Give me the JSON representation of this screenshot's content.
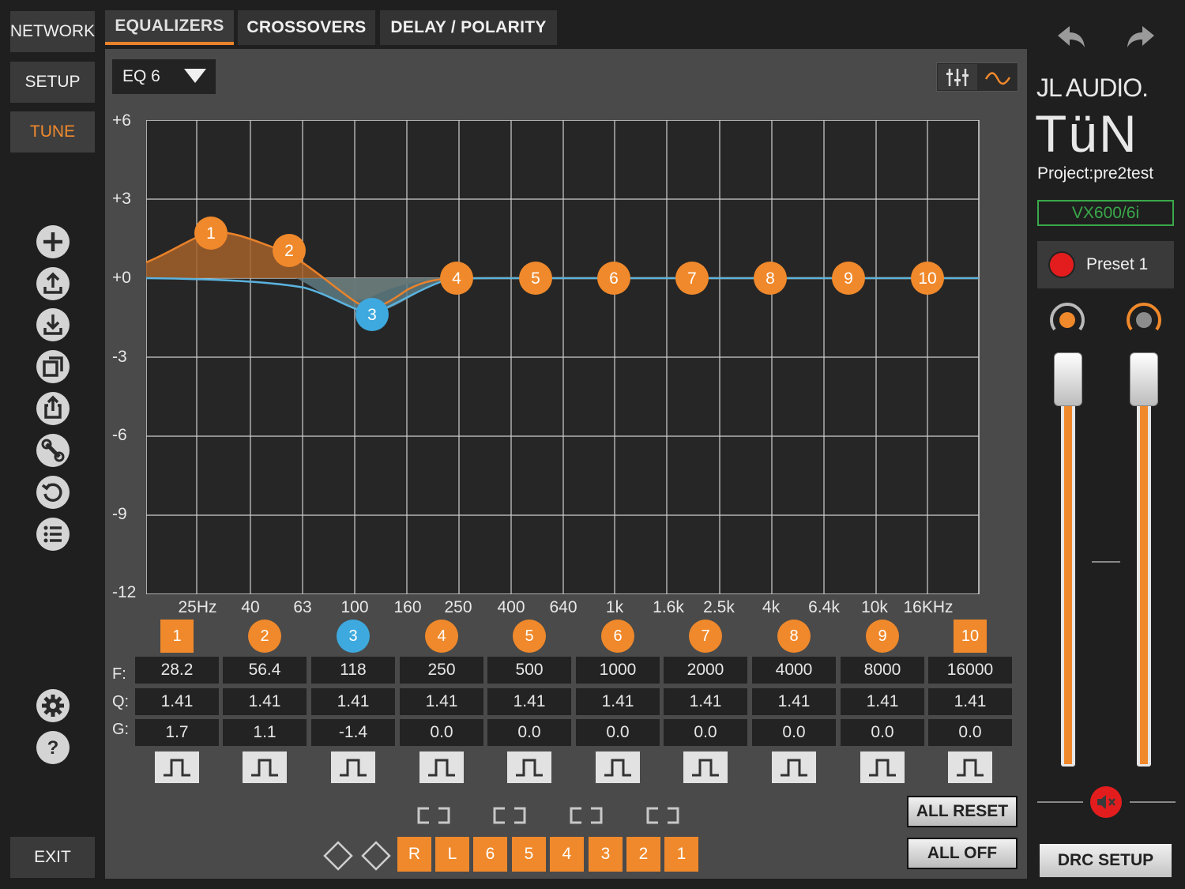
{
  "nav": {
    "network": "NETWORK",
    "setup": "SETUP",
    "tune": "TUNE",
    "exit": "EXIT"
  },
  "tabs": [
    {
      "label": "EQUALIZERS"
    },
    {
      "label": "CROSSOVERS"
    },
    {
      "label": "DELAY / POLARITY"
    }
  ],
  "eq_select": {
    "value": "EQ 6"
  },
  "graph": {
    "y_labels": [
      "+6",
      "+3",
      "+0",
      "-3",
      "-6",
      "-9",
      "-12"
    ],
    "x_labels": [
      "25Hz",
      "40",
      "63",
      "100",
      "160",
      "250",
      "400",
      "640",
      "1k",
      "1.6k",
      "2.5k",
      "4k",
      "6.4k",
      "10k",
      "16KHz"
    ],
    "nodes": [
      "1",
      "2",
      "3",
      "4",
      "5",
      "6",
      "7",
      "8",
      "9",
      "10"
    ]
  },
  "bands": [
    {
      "num": "1",
      "f": "28.2",
      "q": "1.41",
      "g": "1.7"
    },
    {
      "num": "2",
      "f": "56.4",
      "q": "1.41",
      "g": "1.1"
    },
    {
      "num": "3",
      "f": "118",
      "q": "1.41",
      "g": "-1.4"
    },
    {
      "num": "4",
      "f": "250",
      "q": "1.41",
      "g": "0.0"
    },
    {
      "num": "5",
      "f": "500",
      "q": "1.41",
      "g": "0.0"
    },
    {
      "num": "6",
      "f": "1000",
      "q": "1.41",
      "g": "0.0"
    },
    {
      "num": "7",
      "f": "2000",
      "q": "1.41",
      "g": "0.0"
    },
    {
      "num": "8",
      "f": "4000",
      "q": "1.41",
      "g": "0.0"
    },
    {
      "num": "9",
      "f": "8000",
      "q": "1.41",
      "g": "0.0"
    },
    {
      "num": "10",
      "f": "16000",
      "q": "1.41",
      "g": "0.0"
    }
  ],
  "row_labels": {
    "f": "F:",
    "q": "Q:",
    "g": "G:"
  },
  "channels": [
    "R",
    "L",
    "6",
    "5",
    "4",
    "3",
    "2",
    "1"
  ],
  "buttons": {
    "all_reset": "ALL RESET",
    "all_off": "ALL OFF",
    "drc_setup": "DRC SETUP"
  },
  "brand": {
    "line1": "JL AUDIO.",
    "line2": "TüN"
  },
  "project": "Project:pre2test",
  "model": "VX600/6i",
  "preset": "Preset 1",
  "colors": {
    "accent": "#f0892b",
    "selected": "#3ea9de",
    "model_green": "#3aa84a",
    "rec_red": "#e31d1d"
  }
}
